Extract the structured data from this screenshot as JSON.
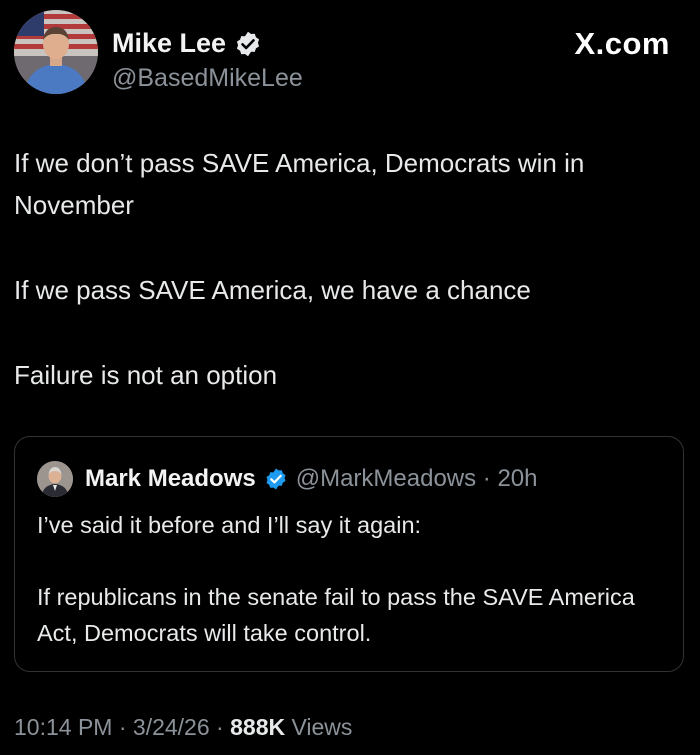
{
  "author": {
    "name": "Mike Lee",
    "handle": "@BasedMikeLee",
    "verified": true,
    "avatar_icon": "avatar-mike-lee"
  },
  "site": {
    "brand": "X.com"
  },
  "tweet": {
    "paragraphs": [
      "If we don’t pass SAVE America, Democrats win in November",
      "If we pass SAVE America, we have a chance",
      "Failure is not an option"
    ]
  },
  "quote": {
    "author_name": "Mark Meadows",
    "handle_time": "@MarkMeadows · 20h",
    "verified": true,
    "paragraphs": [
      "I’ve said it before and I’ll say it again:",
      "If republicans in the senate fail to pass the SAVE America Act, Democrats will take control."
    ]
  },
  "meta": {
    "time": "10:14 PM",
    "date": "3/24/26",
    "separator": "·",
    "views_count": "888K",
    "views_label": "Views"
  },
  "colors": {
    "background": "#000000",
    "text": "#e7e9ea",
    "muted": "#8b9299",
    "verified_blue": "#1d9bf0",
    "border": "#2f3336"
  }
}
